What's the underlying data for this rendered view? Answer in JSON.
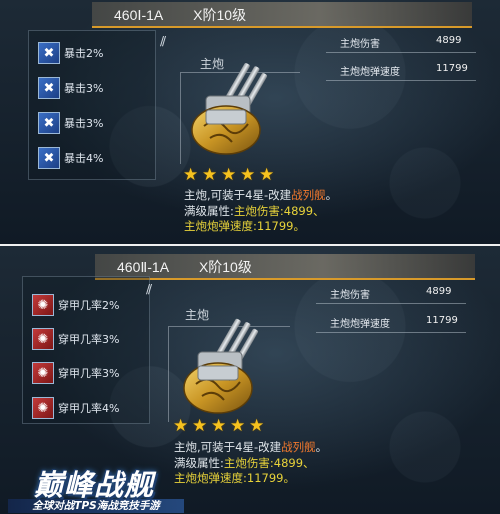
{
  "panels": [
    {
      "title": {
        "name": "460Ⅰ-1A",
        "tier": "X阶10级"
      },
      "stripes": "//",
      "slot_label": "主炮",
      "skills": [
        {
          "label": "暴击2%",
          "icon": "crit-icon"
        },
        {
          "label": "暴击3%",
          "icon": "crit-icon"
        },
        {
          "label": "暴击3%",
          "icon": "crit-icon"
        },
        {
          "label": "暴击4%",
          "icon": "crit-icon"
        }
      ],
      "stats": [
        {
          "label": "主炮伤害",
          "value": "4899"
        },
        {
          "label": "主炮炮弹速度",
          "value": "11799"
        }
      ],
      "stars": 5,
      "desc": {
        "line1_prefix": "主炮,可装于4星-改建",
        "line1_ship": "战列舰",
        "line1_suffix": "。",
        "line2_prefix": "满级属性:",
        "line2_value": "主炮伤害:4899、",
        "line3_value": "主炮炮弹速度:11799。"
      }
    },
    {
      "title": {
        "name": "460Ⅱ-1A",
        "tier": "X阶10级"
      },
      "stripes": "//",
      "slot_label": "主炮",
      "skills": [
        {
          "label": "穿甲几率2%",
          "icon": "armor-pierce-icon"
        },
        {
          "label": "穿甲几率3%",
          "icon": "armor-pierce-icon"
        },
        {
          "label": "穿甲几率3%",
          "icon": "armor-pierce-icon"
        },
        {
          "label": "穿甲几率4%",
          "icon": "armor-pierce-icon"
        }
      ],
      "stats": [
        {
          "label": "主炮伤害",
          "value": "4899"
        },
        {
          "label": "主炮炮弹速度",
          "value": "11799"
        }
      ],
      "stars": 5,
      "desc": {
        "line1_prefix": "主炮,可装于4星-改建",
        "line1_ship": "战列舰",
        "line1_suffix": "。",
        "line2_prefix": "满级属性:",
        "line2_value": "主炮伤害:4899、",
        "line3_value": "主炮炮弹速度:11799。"
      }
    }
  ],
  "logo": {
    "title": "巅峰战舰",
    "subtitle": "全球对战TPS海战竞技手游"
  },
  "colors": {
    "accent_gold": "#d89a2a",
    "star": "#f6c21f",
    "highlight": "#e8d33a",
    "ship_type": "#f0782d"
  }
}
